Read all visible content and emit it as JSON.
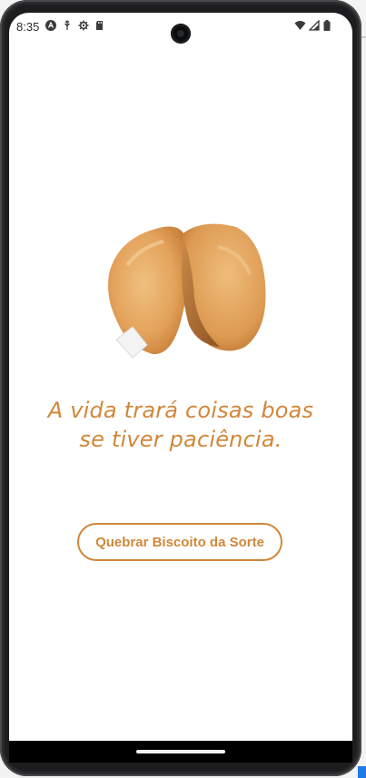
{
  "status_bar": {
    "time": "8:35",
    "left_icons": [
      "android-studio-icon",
      "usb-debug-icon",
      "settings-gear-icon",
      "sd-card-icon"
    ],
    "right_icons": [
      "wifi-icon",
      "cellular-signal-icon",
      "battery-icon"
    ]
  },
  "fortune": {
    "line1": "A vida trará coisas boas",
    "line2": "se tiver paciência."
  },
  "actions": {
    "break_cookie_label": "Quebrar Biscoito da Sorte"
  },
  "colors": {
    "accent": "#d0873a",
    "background": "#ffffff",
    "cookie": "#e3a15d"
  }
}
